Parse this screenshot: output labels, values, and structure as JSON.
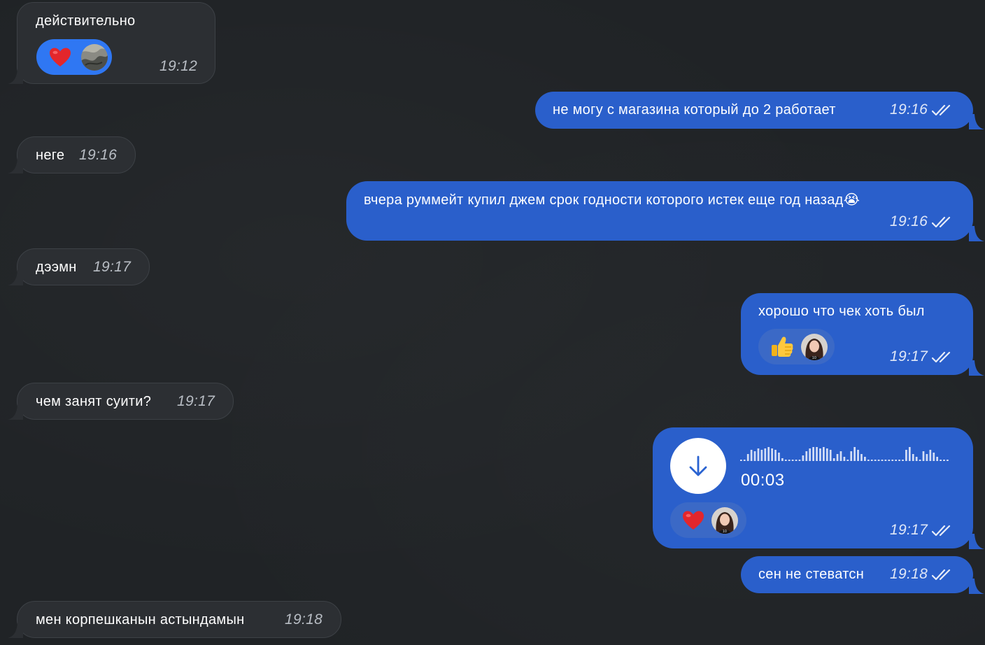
{
  "messages": [
    {
      "side": "in",
      "text": "действительно",
      "time": "19:12",
      "reaction": "heart-icon"
    },
    {
      "side": "out",
      "text": "не могу с магазина который до 2 работает",
      "time": "19:16"
    },
    {
      "side": "in",
      "text": "неге",
      "time": "19:16"
    },
    {
      "side": "out",
      "text": "вчера руммейт купил джем срок годности которого истек еще год назад😭",
      "time": "19:16"
    },
    {
      "side": "in",
      "text": "дээмн",
      "time": "19:17"
    },
    {
      "side": "out",
      "text": "хорошо что чек хоть был",
      "time": "19:17",
      "reaction": "thumbs-up-icon"
    },
    {
      "side": "in",
      "text": "чем занят суити?",
      "time": "19:17"
    },
    {
      "side": "out",
      "type": "voice",
      "duration": "00:03",
      "time": "19:17",
      "reaction": "heart-icon"
    },
    {
      "side": "out",
      "text": "сен не стеватсн",
      "time": "19:18"
    },
    {
      "side": "in",
      "text": "мен корпешканын астындамын",
      "time": "19:18"
    }
  ],
  "colors": {
    "background": "#202326",
    "incoming_bubble": "#2c2f33",
    "outgoing_bubble": "#2a5fcb",
    "reaction_active": "#2f77f3"
  },
  "voice_waveform": [
    2,
    2,
    10,
    16,
    14,
    18,
    16,
    18,
    20,
    18,
    16,
    12,
    4,
    2,
    2,
    2,
    2,
    2,
    8,
    14,
    18,
    20,
    20,
    18,
    20,
    18,
    16,
    4,
    10,
    14,
    6,
    2,
    14,
    20,
    16,
    10,
    6,
    2,
    2,
    2,
    2,
    2,
    2,
    2,
    2,
    2,
    2,
    2,
    16,
    20,
    10,
    6,
    2,
    14,
    10,
    16,
    12,
    6,
    2,
    2,
    2
  ]
}
